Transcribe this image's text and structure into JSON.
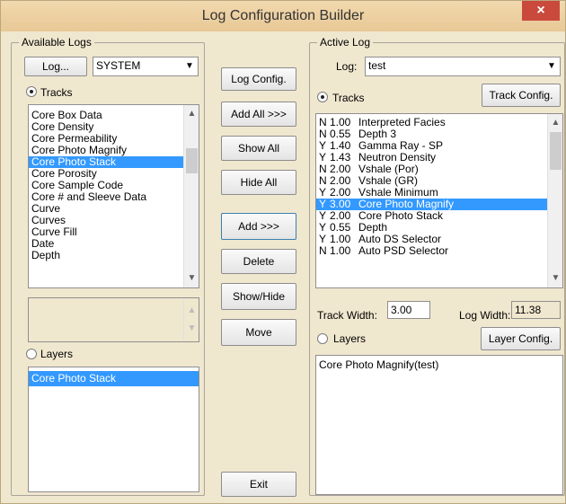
{
  "window": {
    "title": "Log Configuration Builder",
    "close_label": "×"
  },
  "available_logs": {
    "group_label": "Available Logs",
    "log_button": "Log...",
    "log_select_value": "SYSTEM",
    "tracks_label": "Tracks",
    "tracks": [
      "Core Box Data",
      "Core Density",
      "Core Permeability",
      "Core Photo Magnify",
      "Core Photo Stack",
      "Core Porosity",
      "Core Sample Code",
      "Core # and Sleeve Data",
      "Curve",
      "Curves",
      "Curve Fill",
      "Date",
      "Depth"
    ],
    "selected_track_index": 4,
    "layers_label": "Layers",
    "layers": [
      "Core Photo Stack"
    ]
  },
  "middle_buttons": {
    "log_config": "Log Config.",
    "add_all": "Add All >>>",
    "show_all": "Show All",
    "hide_all": "Hide All",
    "add": "Add >>>",
    "delete": "Delete",
    "show_hide": "Show/Hide",
    "move": "Move",
    "exit": "Exit"
  },
  "active_log": {
    "group_label": "Active Log",
    "log_label": "Log:",
    "log_value": "test",
    "tracks_label": "Tracks",
    "track_config": "Track Config.",
    "tracks": [
      {
        "flag": "N",
        "width": "1.00",
        "name": "Interpreted Facies"
      },
      {
        "flag": "N",
        "width": "0.55",
        "name": "Depth 3"
      },
      {
        "flag": "Y",
        "width": "1.40",
        "name": "Gamma Ray - SP"
      },
      {
        "flag": "Y",
        "width": "1.43",
        "name": "Neutron Density"
      },
      {
        "flag": "N",
        "width": "2.00",
        "name": "Vshale (Por)"
      },
      {
        "flag": "N",
        "width": "2.00",
        "name": "Vshale (GR)"
      },
      {
        "flag": "Y",
        "width": "2.00",
        "name": "Vshale Minimum"
      },
      {
        "flag": "Y",
        "width": "3.00",
        "name": "Core Photo Magnify"
      },
      {
        "flag": "Y",
        "width": "2.00",
        "name": "Core Photo Stack"
      },
      {
        "flag": "Y",
        "width": "0.55",
        "name": "Depth"
      },
      {
        "flag": "Y",
        "width": "1.00",
        "name": "Auto DS Selector"
      },
      {
        "flag": "N",
        "width": "1.00",
        "name": "Auto PSD Selector"
      }
    ],
    "selected_track_index": 7,
    "track_width_label": "Track Width:",
    "track_width_value": "3.00",
    "log_width_label": "Log Width:",
    "log_width_value": "11.38",
    "layers_label": "Layers",
    "layer_config": "Layer Config.",
    "layers": [
      "Core Photo Magnify(test)"
    ]
  },
  "colors": {
    "selection": "#3399ff",
    "dialog_bg": "#f0e7cf",
    "close": "#c94a3c"
  }
}
